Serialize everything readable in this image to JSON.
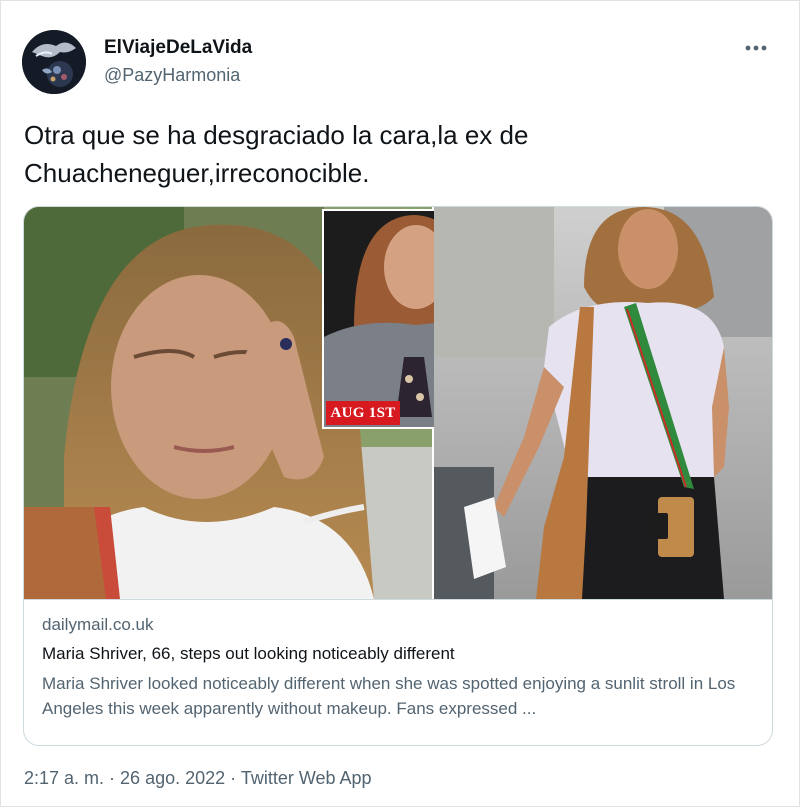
{
  "author": {
    "display_name": "ElViajeDeLaVida",
    "handle": "@PazyHarmonia"
  },
  "menu_icon": "more-horizontal-icon",
  "tweet": {
    "text": "Otra que se ha desgraciado la cara,la ex de\nChuacheneguer,irreconocible."
  },
  "card": {
    "badge": "AUG 1ST",
    "domain": "dailymail.co.uk",
    "title": "Maria Shriver, 66, steps out looking noticeably different",
    "description": "Maria Shriver looked noticeably different when she was spotted enjoying a sunlit stroll in Los Angeles this week apparently without makeup. Fans expressed ..."
  },
  "footer": {
    "time": "2:17 a. m.",
    "separator": " · ",
    "date": "26 ago. 2022",
    "source": "Twitter Web App"
  },
  "colors": {
    "text_primary": "#0f1419",
    "text_secondary": "#536471",
    "border": "#cfd9de",
    "badge_red": "#d71920"
  }
}
